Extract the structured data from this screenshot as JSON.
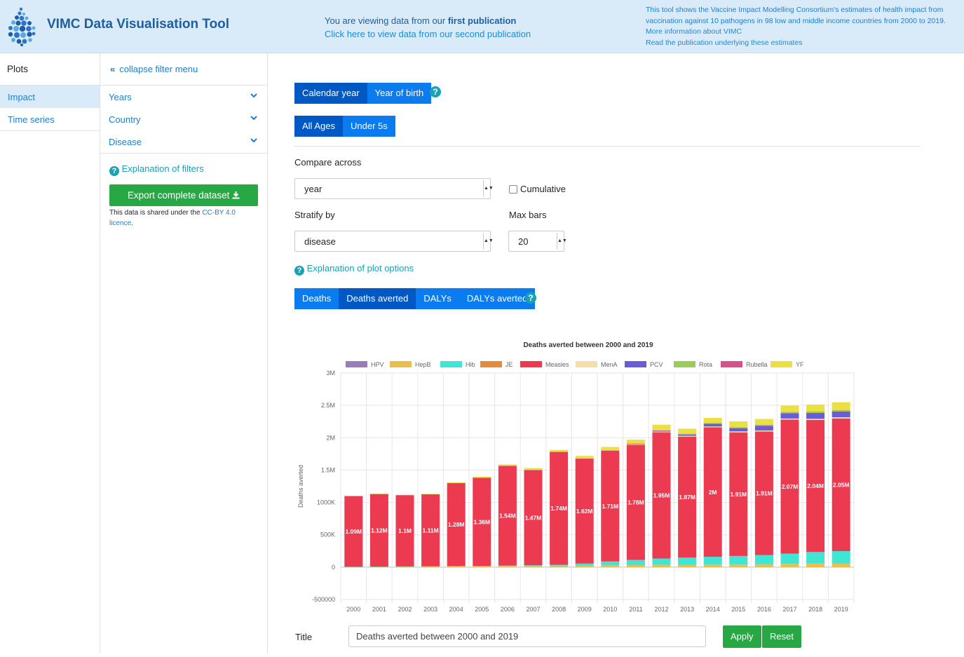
{
  "header": {
    "app_title": "VIMC Data Visualisation Tool",
    "viewing_prefix": "You are viewing data from our ",
    "viewing_bold": "first publication",
    "second_pub_link": "Click here to view data from our second publication",
    "about_desc": "This tool shows the Vaccine Impact Modelling Consortium's estimates of health impact from vaccination against 10 pathogens in 98 low and middle income countries from 2000 to 2019.",
    "about_link": "More information about VIMC",
    "publication_link": "Read the publication underlying these estimates"
  },
  "plots_nav": {
    "header": "Plots",
    "items": [
      {
        "label": "Impact",
        "active": true
      },
      {
        "label": "Time series",
        "active": false
      }
    ]
  },
  "filters": {
    "collapse_label": "collapse filter menu",
    "items": [
      {
        "label": "Years"
      },
      {
        "label": "Country"
      },
      {
        "label": "Disease"
      }
    ],
    "explanation": "Explanation of filters",
    "export_label": "Export complete dataset",
    "licence_prefix": "This data is shared under the ",
    "licence_link": "CC-BY 4.0 licence",
    "licence_suffix": "."
  },
  "controls": {
    "year_mode": [
      {
        "label": "Calendar year",
        "selected": true
      },
      {
        "label": "Year of birth",
        "selected": false
      }
    ],
    "age_mode": [
      {
        "label": "All Ages",
        "selected": true
      },
      {
        "label": "Under 5s",
        "selected": false
      }
    ],
    "compare_label": "Compare across",
    "compare_value": "year",
    "cumulative_label": "Cumulative",
    "stratify_label": "Stratify by",
    "stratify_value": "disease",
    "max_bars_label": "Max bars",
    "max_bars_value": "20",
    "plot_explanation": "Explanation of plot options",
    "metric_tabs": [
      {
        "label": "Deaths",
        "selected": false
      },
      {
        "label": "Deaths averted",
        "selected": true
      },
      {
        "label": "DALYs",
        "selected": false
      },
      {
        "label": "DALYs averted",
        "selected": false
      }
    ],
    "title_label": "Title",
    "title_value": "Deaths averted between 2000 and 2019",
    "apply_label": "Apply",
    "reset_label": "Reset"
  },
  "chart_data": {
    "type": "bar",
    "stacked": true,
    "title": "Deaths averted between 2000 and 2019",
    "ylabel": "Deaths averted",
    "xlabel": "",
    "ylim": [
      -500000,
      3000000
    ],
    "yticks": [
      -500000,
      0,
      500000,
      1000000,
      1500000,
      2000000,
      2500000,
      3000000
    ],
    "ytick_labels": [
      "-500000",
      "0",
      "500K",
      "1000K",
      "1.5M",
      "2M",
      "2.5M",
      "3M"
    ],
    "grid": true,
    "legend_position": "top",
    "categories": [
      "2000",
      "2001",
      "2002",
      "2003",
      "2004",
      "2005",
      "2006",
      "2007",
      "2008",
      "2009",
      "2010",
      "2011",
      "2012",
      "2013",
      "2014",
      "2015",
      "2016",
      "2017",
      "2018",
      "2019"
    ],
    "series": [
      {
        "name": "HPV",
        "color": "#9b7bb8",
        "values": [
          0,
          0,
          0,
          0,
          0,
          0,
          0,
          0,
          0,
          0,
          0,
          0,
          0,
          0,
          0,
          0,
          0,
          0,
          0,
          0
        ]
      },
      {
        "name": "HepB",
        "color": "#e9c04d",
        "values": [
          5000,
          7000,
          9000,
          11000,
          13000,
          15000,
          17000,
          19000,
          22000,
          25000,
          28000,
          31000,
          34000,
          37000,
          40000,
          43000,
          46000,
          50000,
          54000,
          58000
        ]
      },
      {
        "name": "Hib",
        "color": "#3ee6d3",
        "values": [
          1000,
          1000,
          2000,
          3000,
          4000,
          5000,
          7000,
          10000,
          15000,
          30000,
          60000,
          80000,
          100000,
          110000,
          120000,
          130000,
          140000,
          160000,
          180000,
          190000
        ]
      },
      {
        "name": "JE",
        "color": "#e58c3c",
        "values": [
          0,
          0,
          0,
          0,
          0,
          0,
          0,
          0,
          0,
          0,
          0,
          0,
          0,
          0,
          0,
          0,
          0,
          0,
          0,
          0
        ]
      },
      {
        "name": "Measles",
        "color": "#ec3a50",
        "values": [
          1090000,
          1120000,
          1100000,
          1110000,
          1280000,
          1360000,
          1540000,
          1470000,
          1740000,
          1620000,
          1710000,
          1780000,
          1950000,
          1870000,
          2000000,
          1910000,
          1910000,
          2070000,
          2040000,
          2050000
        ]
      },
      {
        "name": "MenA",
        "color": "#f5dfa8",
        "values": [
          0,
          0,
          0,
          0,
          0,
          0,
          0,
          0,
          0,
          0,
          5000,
          10000,
          12000,
          13000,
          14000,
          15000,
          16000,
          17000,
          18000,
          18000
        ]
      },
      {
        "name": "PCV",
        "color": "#6a5cd6",
        "values": [
          0,
          0,
          0,
          0,
          0,
          0,
          0,
          0,
          0,
          0,
          0,
          5000,
          10000,
          20000,
          40000,
          50000,
          70000,
          80000,
          90000,
          90000
        ]
      },
      {
        "name": "Rota",
        "color": "#9acd5c",
        "values": [
          0,
          0,
          0,
          0,
          0,
          0,
          0,
          0,
          0,
          0,
          0,
          0,
          0,
          5000,
          8000,
          10000,
          12000,
          14000,
          15000,
          16000
        ]
      },
      {
        "name": "Rubella",
        "color": "#d6538a",
        "values": [
          2000,
          2000,
          2000,
          2000,
          3000,
          3000,
          3000,
          3000,
          4000,
          4000,
          4000,
          4000,
          5000,
          5000,
          5000,
          5000,
          6000,
          6000,
          6000,
          6000
        ]
      },
      {
        "name": "YF",
        "color": "#ebe042",
        "values": [
          5000,
          5000,
          5000,
          6000,
          10000,
          15000,
          20000,
          30000,
          30000,
          40000,
          50000,
          60000,
          90000,
          80000,
          80000,
          90000,
          90000,
          100000,
          110000,
          120000
        ]
      }
    ],
    "bar_labels": [
      "1.09M",
      "1.12M",
      "1.1M",
      "1.11M",
      "1.28M",
      "1.36M",
      "1.54M",
      "1.47M",
      "1.74M",
      "1.62M",
      "1.71M",
      "1.78M",
      "1.95M",
      "1.87M",
      "2M",
      "1.91M",
      "1.91M",
      "2.07M",
      "2.04M",
      "2.05M"
    ]
  }
}
